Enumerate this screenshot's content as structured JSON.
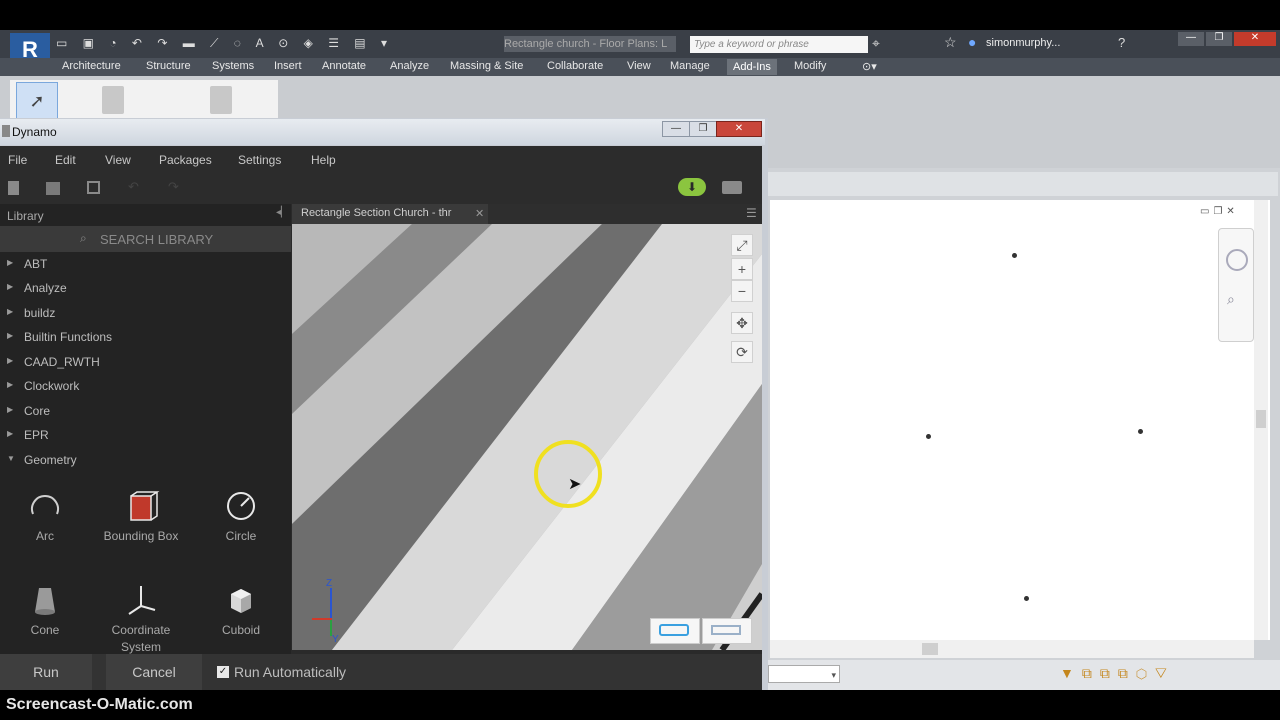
{
  "revit": {
    "document_title": "Rectangle church - Floor Plans: L",
    "search_placeholder": "Type a keyword or phrase",
    "user": "simonmurphy...",
    "ribbon_tabs": [
      "Architecture",
      "Structure",
      "Systems",
      "Insert",
      "Annotate",
      "Analyze",
      "Massing & Site",
      "Collaborate",
      "View",
      "Manage",
      "Add-Ins",
      "Modify"
    ],
    "active_tab": "Add-Ins"
  },
  "dynamo": {
    "window_title": "Dynamo",
    "menu": [
      "File",
      "Edit",
      "View",
      "Packages",
      "Settings",
      "Help"
    ],
    "library_title": "Library",
    "search_placeholder": "SEARCH LIBRARY",
    "categories": [
      "ABT",
      "Analyze",
      "buildz",
      "Builtin Functions",
      "CAAD_RWTH",
      "Clockwork",
      "Core",
      "EPR",
      "Geometry"
    ],
    "expanded_category": "Geometry",
    "nodes": [
      {
        "label": "Arc",
        "icon": "arc-icon"
      },
      {
        "label": "Bounding Box",
        "icon": "bounding-box-icon"
      },
      {
        "label": "Circle",
        "icon": "circle-icon"
      },
      {
        "label": "Cone",
        "icon": "cone-icon"
      },
      {
        "label": "Coordinate System",
        "icon": "coordinate-system-icon"
      },
      {
        "label": "Cuboid",
        "icon": "cuboid-icon"
      }
    ],
    "workspace_tab": "Rectangle Section Church - thr",
    "run_label": "Run",
    "cancel_label": "Cancel",
    "run_automatically_label": "Run Automatically",
    "run_automatically_checked": true,
    "axis_labels": {
      "z": "Z",
      "x": "X",
      "y": "Y"
    }
  },
  "watermark": "Screencast-O-Matic.com",
  "colors": {
    "accent_green": "#8bc53f",
    "cursor_highlight": "#f0e020",
    "revit_blue": "#1f5fa8"
  }
}
